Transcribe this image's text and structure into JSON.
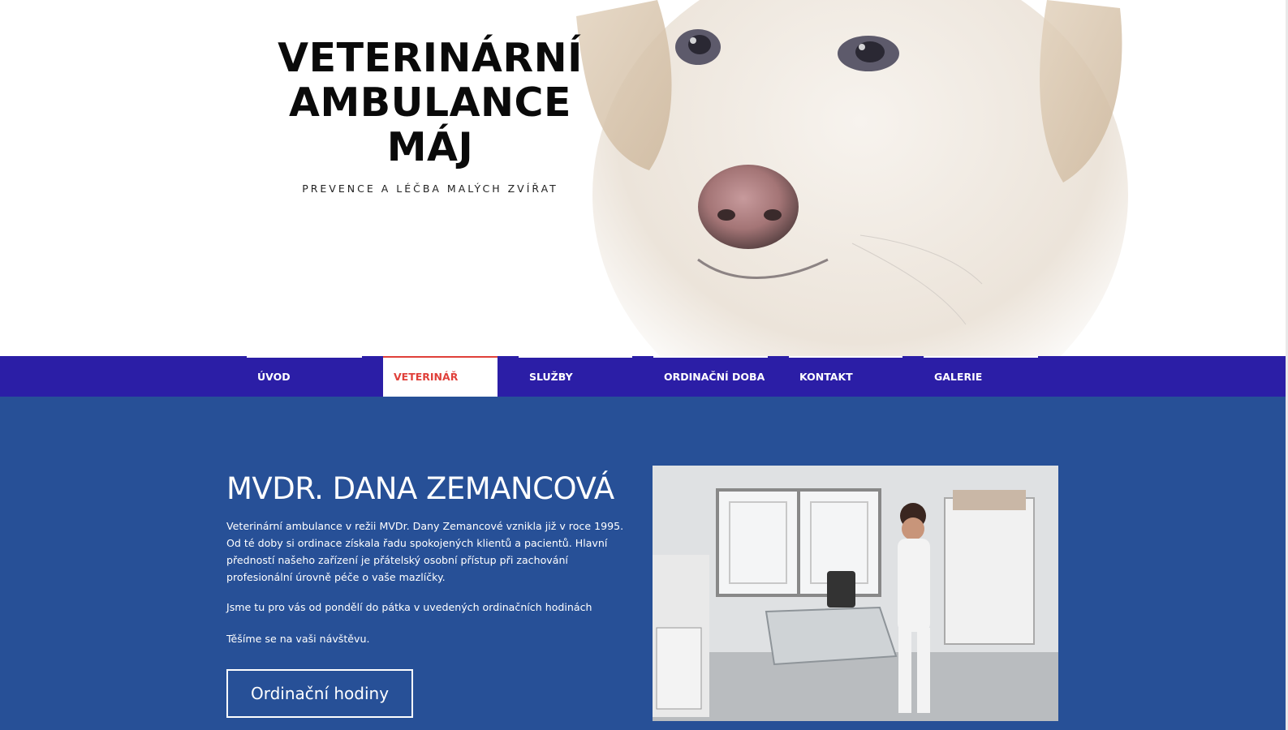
{
  "hero": {
    "title_line1": "VETERINÁRNÍ",
    "title_line2": "AMBULANCE",
    "title_line3": "MÁJ",
    "tagline": "PREVENCE A LÉČBA MALÝCH ZVÍŘAT",
    "image_icon": "dog-photo-icon"
  },
  "nav": {
    "items": [
      {
        "label": "ÚVOD",
        "active": false
      },
      {
        "label": "VETERINÁŘ",
        "active": true
      },
      {
        "label": "SLUŽBY",
        "active": false
      },
      {
        "label": "ORDINAČNÍ DOBA",
        "active": false
      },
      {
        "label": "KONTAKT",
        "active": false
      },
      {
        "label": "GALERIE",
        "active": false
      }
    ]
  },
  "main": {
    "heading": "MVDR. DANA ZEMANCOVÁ",
    "paragraphs": [
      "Veterinární ambulance v režii MVDr. Dany Zemancové vznikla již v roce 1995. Od té doby si ordinace získala řadu spokojených klientů a pacientů. Hlavní předností našeho zařízení je přátelský osobní přístup při zachování profesionální úrovně péče o vaše mazlíčky.",
      "Jsme tu pro vás od pondělí do pátka v uvedených ordinačních hodinách",
      "Těšíme se na vaši návštěvu."
    ],
    "button_label": "Ordinační hodiny",
    "photo_icon": "clinic-photo-icon"
  },
  "colors": {
    "nav_bg": "#2b1ea6",
    "main_bg": "#275097",
    "active_nav": "#e0403a"
  }
}
